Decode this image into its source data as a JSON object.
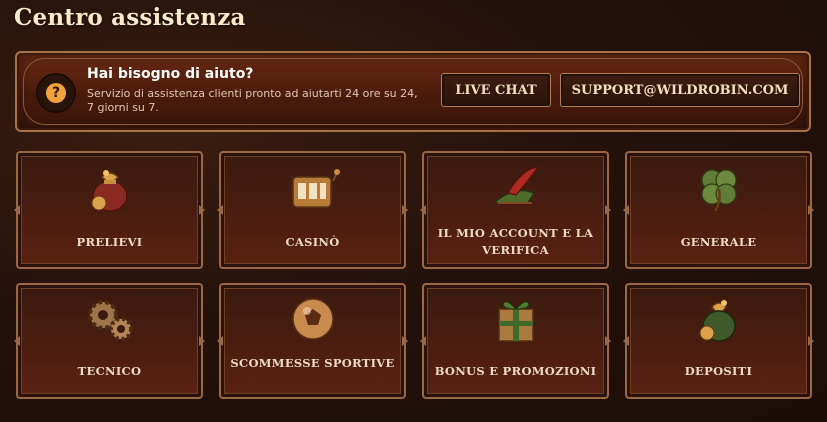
{
  "page": {
    "title": "Centro assistenza"
  },
  "help": {
    "title": "Hai bisogno di aiuto?",
    "description": "Servizio di assistenza clienti pronto ad aiutarti 24 ore su 24, 7 giorni su 7.",
    "icon": "question-icon",
    "icon_glyph": "?",
    "live_chat_label": "LIVE CHAT",
    "email_label": "SUPPORT@WILDROBIN.COM"
  },
  "categories": [
    {
      "label": "PRELIEVI",
      "icon": "money-bag-icon"
    },
    {
      "label": "CASINÒ",
      "icon": "slot-machine-icon"
    },
    {
      "label": "IL MIO ACCOUNT E LA VERIFICA",
      "icon": "feathered-hat-icon"
    },
    {
      "label": "GENERALE",
      "icon": "four-leaf-clover-icon"
    },
    {
      "label": "TECNICO",
      "icon": "gears-icon"
    },
    {
      "label": "SCOMMESSE SPORTIVE",
      "icon": "football-icon"
    },
    {
      "label": "BONUS E PROMOZIONI",
      "icon": "gift-box-icon"
    },
    {
      "label": "DEPOSITI",
      "icon": "coin-bag-icon"
    }
  ],
  "colors": {
    "accent": "#f1a23a",
    "border": "#9a6845",
    "background": "#24110a"
  }
}
